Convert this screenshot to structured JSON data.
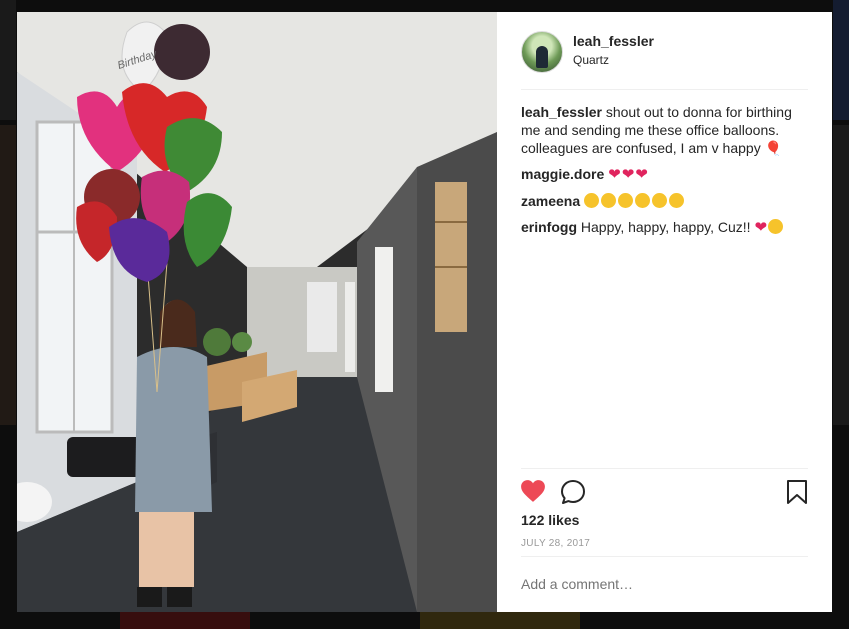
{
  "post": {
    "author": "leah_fessler",
    "location": "Quartz",
    "caption": "shout out to donna for birthing me and sending me these office balloons. colleagues are confused, I am v happy",
    "balloon_label": "Birthday",
    "likes": "122 likes",
    "date": "JULY 28, 2017"
  },
  "comments": [
    {
      "user": "maggie.dore",
      "text": ""
    },
    {
      "user": "zameena",
      "text": ""
    },
    {
      "user": "erinfogg",
      "text": "Happy, happy, happy, Cuz!!"
    }
  ],
  "composer": {
    "placeholder": "Add a comment…"
  },
  "icons": {
    "like": "heart-icon",
    "comment": "comment-bubble-icon",
    "save": "bookmark-icon",
    "close": "close-icon"
  },
  "colors": {
    "like_red": "#ed4956",
    "text": "#262626",
    "muted": "#999999"
  }
}
